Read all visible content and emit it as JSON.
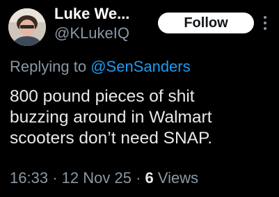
{
  "author": {
    "display_name": "Luke We...",
    "handle": "@KLukeIQ",
    "avatar_icon": "user-avatar-photo"
  },
  "actions": {
    "follow_label": "Follow",
    "more_icon": "more-vertical-icon"
  },
  "reply": {
    "prefix": "Replying to",
    "mention": "@SenSanders"
  },
  "tweet": {
    "lines": [
      "800 pound pieces of shit",
      "buzzing around in Walmart",
      "scooters don’t need SNAP."
    ]
  },
  "meta": {
    "time": "16:33",
    "date": "12 Nov 25",
    "views_count": "6",
    "views_label": "Views"
  },
  "colors": {
    "background": "#000000",
    "text": "#e7e9ea",
    "secondary": "#8b98a5",
    "link": "#1d9bf0",
    "follow_bg": "#ffffff"
  }
}
